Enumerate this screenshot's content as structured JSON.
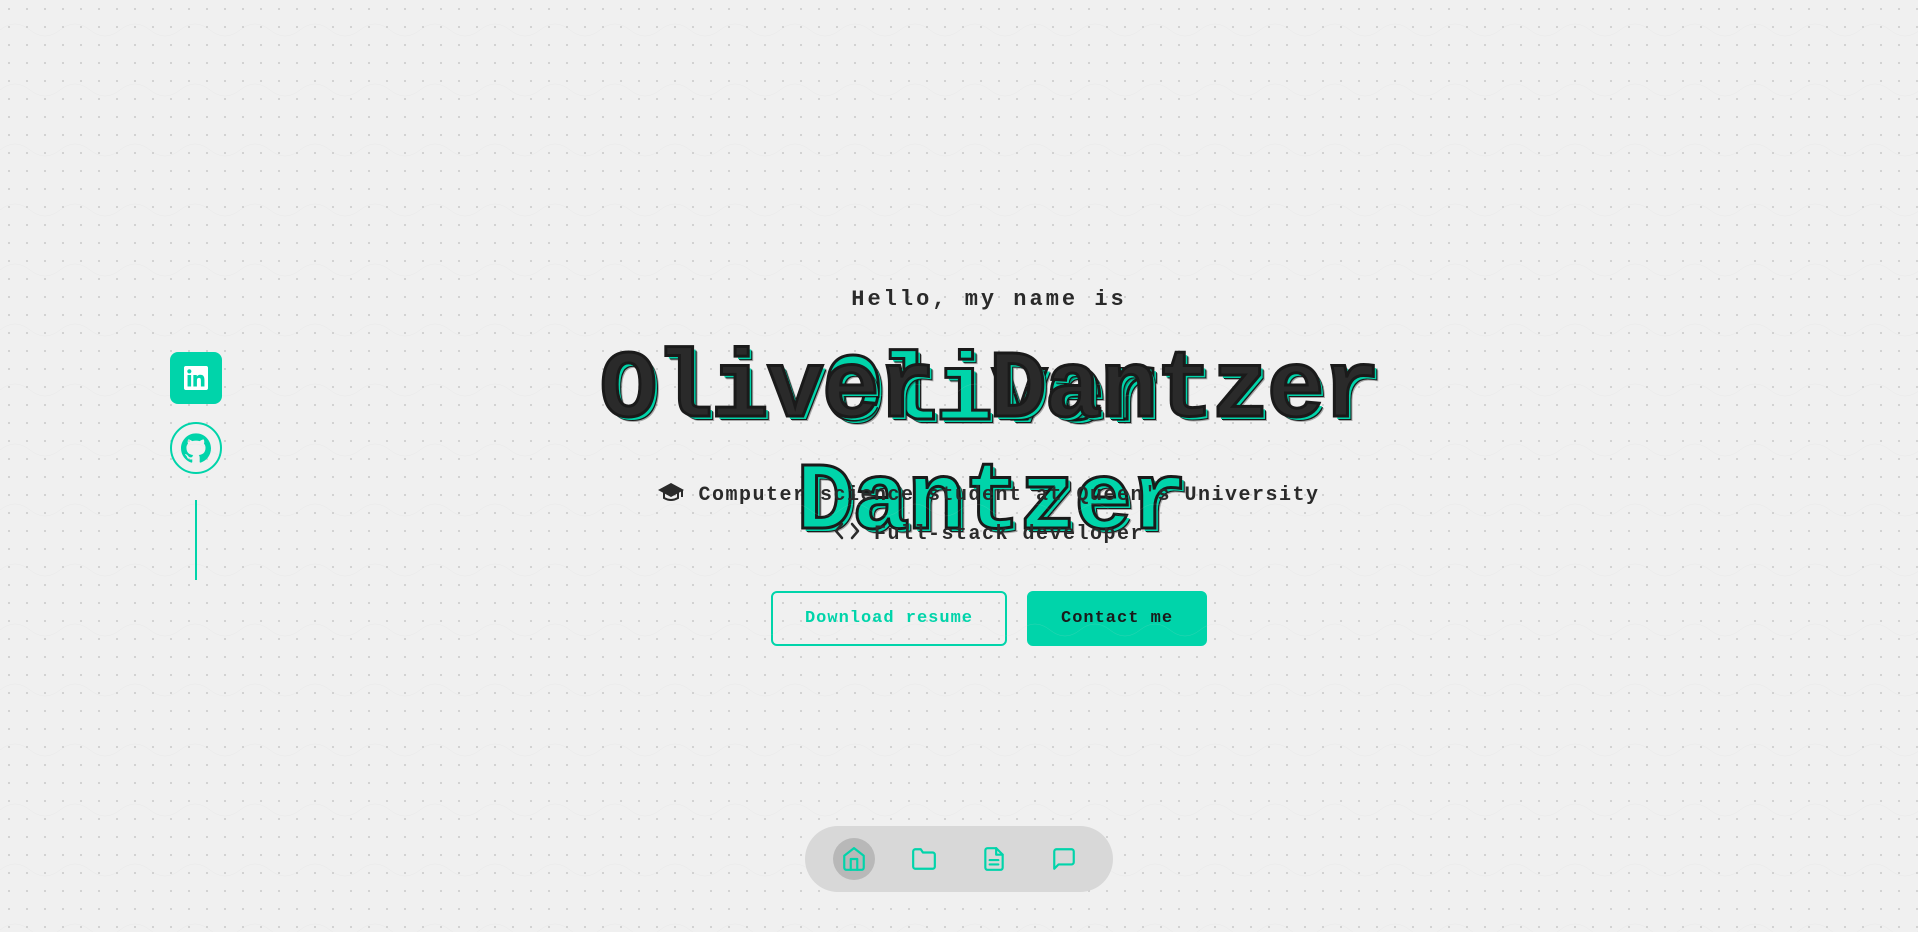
{
  "greeting": "Hello, my name is",
  "name": "Oliver Dantzer",
  "taglines": [
    {
      "icon": "graduation-cap",
      "text": "Computer science student at Queen's University"
    },
    {
      "icon": "code-brackets",
      "text": "Full-stack developer"
    }
  ],
  "buttons": {
    "download": "Download resume",
    "contact": "Contact me"
  },
  "social": {
    "linkedin_label": "LinkedIn",
    "github_label": "GitHub"
  },
  "nav": {
    "items": [
      "home",
      "folder",
      "document",
      "chat"
    ]
  },
  "colors": {
    "teal": "#00d4aa",
    "dark": "#2a2a2a",
    "bg": "#f0f0f0"
  }
}
